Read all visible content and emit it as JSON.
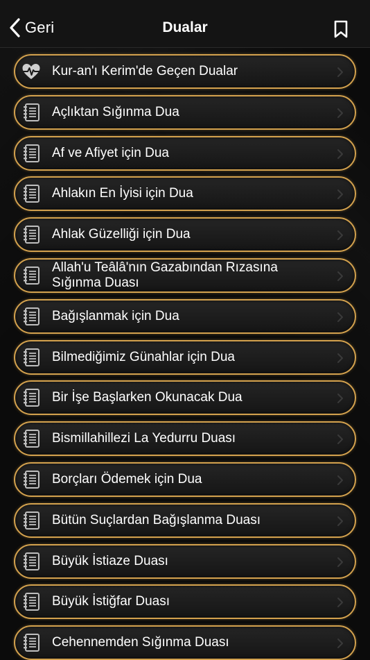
{
  "nav": {
    "back_label": "Geri",
    "title": "Dualar",
    "bookmark_icon": "bookmark-icon"
  },
  "colors": {
    "background": "#0b0b0b",
    "navbar": "#141414",
    "row_border": "#d4a24e",
    "text": "#ffffff",
    "chevron": "#3a3a3a"
  },
  "items": [
    {
      "label": "Kur-an'ı Kerim'de Geçen Dualar",
      "icon": "heartbeat-icon"
    },
    {
      "label": "Açlıktan Sığınma Dua",
      "icon": "notebook-icon"
    },
    {
      "label": "Af ve Afiyet için Dua",
      "icon": "notebook-icon"
    },
    {
      "label": "Ahlakın En İyisi için Dua",
      "icon": "notebook-icon"
    },
    {
      "label": "Ahlak Güzelliği için Dua",
      "icon": "notebook-icon"
    },
    {
      "label": "Allah'u Teâlâ'nın Gazabından Rızasına Sığınma Duası",
      "icon": "notebook-icon"
    },
    {
      "label": "Bağışlanmak için Dua",
      "icon": "notebook-icon"
    },
    {
      "label": "Bilmediğimiz Günahlar için Dua",
      "icon": "notebook-icon"
    },
    {
      "label": "Bir İşe Başlarken Okunacak Dua",
      "icon": "notebook-icon"
    },
    {
      "label": "Bismillahillezi La Yedurru Duası",
      "icon": "notebook-icon"
    },
    {
      "label": "Borçları Ödemek için Dua",
      "icon": "notebook-icon"
    },
    {
      "label": "Bütün Suçlardan Bağışlanma Duası",
      "icon": "notebook-icon"
    },
    {
      "label": "Büyük İstiaze Duası",
      "icon": "notebook-icon"
    },
    {
      "label": "Büyük İstiğfar Duası",
      "icon": "notebook-icon"
    },
    {
      "label": "Cehennemden Sığınma Duası",
      "icon": "notebook-icon"
    }
  ]
}
